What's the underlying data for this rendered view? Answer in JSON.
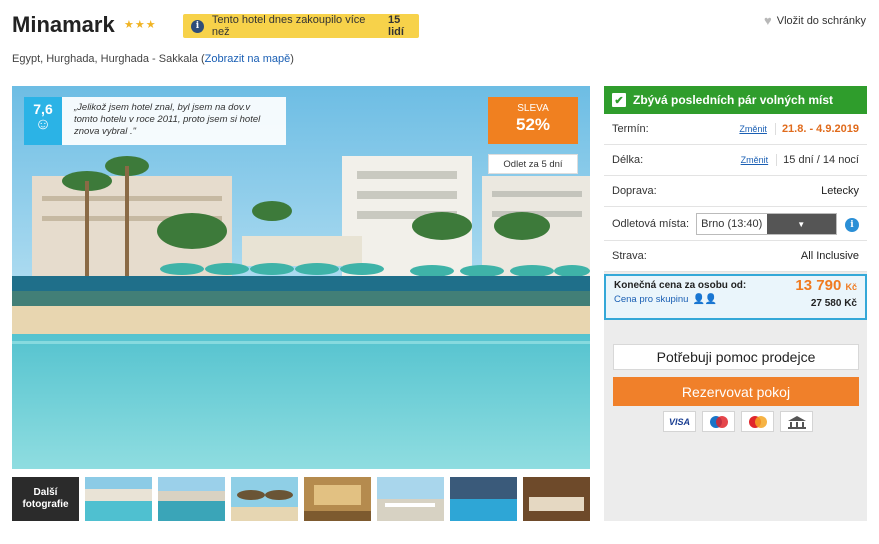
{
  "hotel": {
    "name": "Minamark",
    "stars": "★★★",
    "location": "Egypt, Hurghada, Hurghada - Sakkala",
    "map_link": "Zobrazit na mapě"
  },
  "notice": {
    "text": "Tento hotel dnes zakoupilo více než",
    "count": "15 lidí"
  },
  "wishlist_label": "Vložit do schránky",
  "review": {
    "score": "7,6",
    "quote": "„Jelikož jsem hotel znal, byl jsem na dov.v tomto hotelu v roce 2011, proto jsem si hotel znova vybral .\""
  },
  "discount": {
    "label": "SLEVA",
    "value": "52%",
    "departure_note": "Odlet za 5 dní"
  },
  "gallery": {
    "more_label": "Další fotografie",
    "thumbnails": [
      "pool-resort",
      "harbor",
      "beach-umbrellas",
      "lobby",
      "beach-chairs",
      "indoor-pool",
      "restaurant"
    ]
  },
  "booking": {
    "availability": "Zbývá posledních pár volných míst",
    "term": {
      "label": "Termín:",
      "change": "Změnit",
      "value": "21.8. - 4.9.2019"
    },
    "length": {
      "label": "Délka:",
      "change": "Změnit",
      "value": "15 dní / 14 nocí"
    },
    "transport": {
      "label": "Doprava:",
      "value": "Letecky"
    },
    "departure": {
      "label": "Odletová místa:",
      "value": "Brno (13:40)"
    },
    "board": {
      "label": "Strava:",
      "value": "All Inclusive"
    },
    "price": {
      "label": "Konečná cena za osobu od:",
      "group_label": "Cena pro skupinu",
      "per_person": "13 790",
      "currency": "Kč",
      "group_total": "27 580 Kč"
    },
    "help_button": "Potřebuji pomoc prodejce",
    "book_button": "Rezervovat pokoj"
  },
  "payment_cards": [
    "VISA",
    "Maestro",
    "MasterCard",
    "Bank"
  ]
}
